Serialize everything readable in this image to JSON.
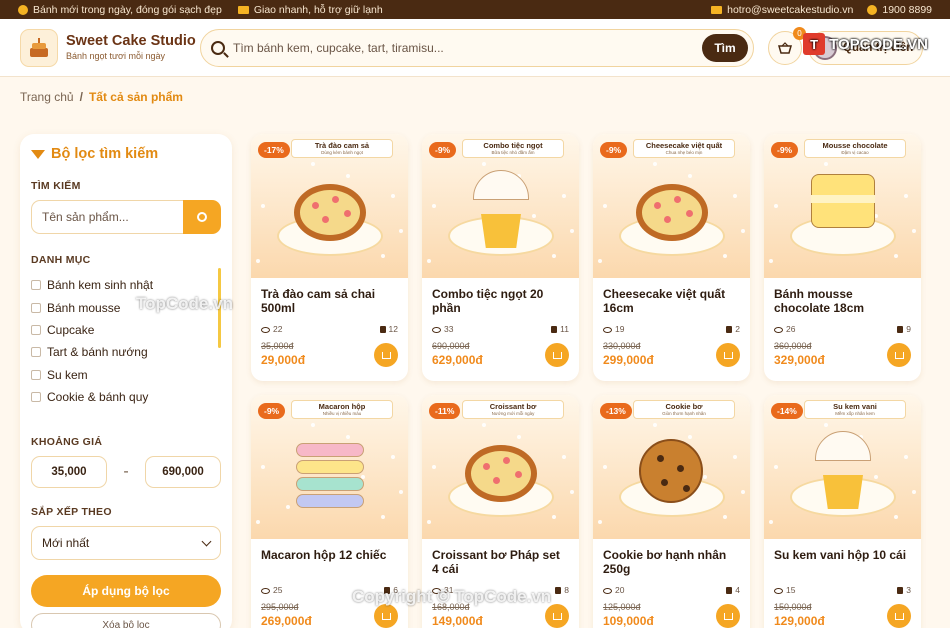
{
  "topbar": {
    "fresh": "Bánh mới trong ngày, đóng gói sạch đẹp",
    "delivery": "Giao nhanh, hỗ trợ giữ lạnh",
    "email": "hotro@sweetcakestudio.vn",
    "phone": "1900 8899"
  },
  "header": {
    "brand_title": "Sweet Cake Studio",
    "brand_subtitle": "Bánh ngọt tươi mỗi ngày",
    "search_placeholder": "Tìm bánh kem, cupcake, tart, tiramisu...",
    "search_button": "Tìm",
    "cart_count": "0",
    "user_name": "Quản trị viên",
    "partner_logo": "TOPCODE.VN"
  },
  "breadcrumb": {
    "home": "Trang chủ",
    "current": "Tất cả sản phẩm"
  },
  "sidebar": {
    "title": "Bộ lọc tìm kiếm",
    "search_label": "TÌM KIẾM",
    "search_placeholder": "Tên sản phẩm...",
    "category_label": "DANH MỤC",
    "categories": [
      "Bánh kem sinh nhật",
      "Bánh mousse",
      "Cupcake",
      "Tart & bánh nướng",
      "Su kem",
      "Cookie & bánh quy"
    ],
    "price_label": "KHOẢNG GIÁ",
    "price_min": "35,000",
    "price_sep": "-",
    "price_max": "690,000",
    "sort_label": "SẮP XẾP THEO",
    "sort_value": "Mới nhất",
    "apply_button": "Áp dụng bộ lọc",
    "clear_button": "Xóa bộ lọc"
  },
  "products": [
    {
      "name": "Trà đào cam sả chai 500ml",
      "discount": "-17%",
      "tag": "Trà đào cam sả",
      "tag_sub": "Dùng kèm bánh ngọt",
      "views": "22",
      "sold": "12",
      "old": "35,000đ",
      "price": "29,000đ",
      "art": "pie"
    },
    {
      "name": "Combo tiệc ngọt 20 phần",
      "discount": "-9%",
      "tag": "Combo tiệc ngọt",
      "tag_sub": "Bữa tiệc nhỏ đầm ấm",
      "views": "33",
      "sold": "11",
      "old": "690,000đ",
      "price": "629,000đ",
      "art": "cupcake"
    },
    {
      "name": "Cheesecake việt quất 16cm",
      "discount": "-9%",
      "tag": "Cheesecake việt quất",
      "tag_sub": "Chua nhẹ béo mịn",
      "views": "19",
      "sold": "2",
      "old": "330,000đ",
      "price": "299,000đ",
      "art": "pie"
    },
    {
      "name": "Bánh mousse chocolate 18cm",
      "discount": "-9%",
      "tag": "Mousse chocolate",
      "tag_sub": "Đậm vị cacao",
      "views": "26",
      "sold": "9",
      "old": "360,000đ",
      "price": "329,000đ",
      "art": "cake"
    },
    {
      "name": "Macaron hộp 12 chiếc",
      "discount": "-9%",
      "tag": "Macaron hộp",
      "tag_sub": "Nhiều vị nhiều màu",
      "views": "25",
      "sold": "6",
      "old": "295,000đ",
      "price": "269,000đ",
      "art": "macaron"
    },
    {
      "name": "Croissant bơ Pháp set 4 cái",
      "discount": "-11%",
      "tag": "Croissant bơ",
      "tag_sub": "Nướng mới mỗi ngày",
      "views": "31",
      "sold": "8",
      "old": "168,000đ",
      "price": "149,000đ",
      "art": "pie"
    },
    {
      "name": "Cookie bơ hạnh nhân 250g",
      "discount": "-13%",
      "tag": "Cookie bơ",
      "tag_sub": "Giòn thơm hạnh nhân",
      "views": "20",
      "sold": "4",
      "old": "125,000đ",
      "price": "109,000đ",
      "art": "cookie"
    },
    {
      "name": "Su kem vani hộp 10 cái",
      "discount": "-14%",
      "tag": "Su kem vani",
      "tag_sub": "Mềm xốp nhân kem",
      "views": "15",
      "sold": "3",
      "old": "150,000đ",
      "price": "129,000đ",
      "art": "cupcake"
    }
  ],
  "watermarks": [
    "TopCode.vn",
    "Copyright © TopCode.vn"
  ]
}
